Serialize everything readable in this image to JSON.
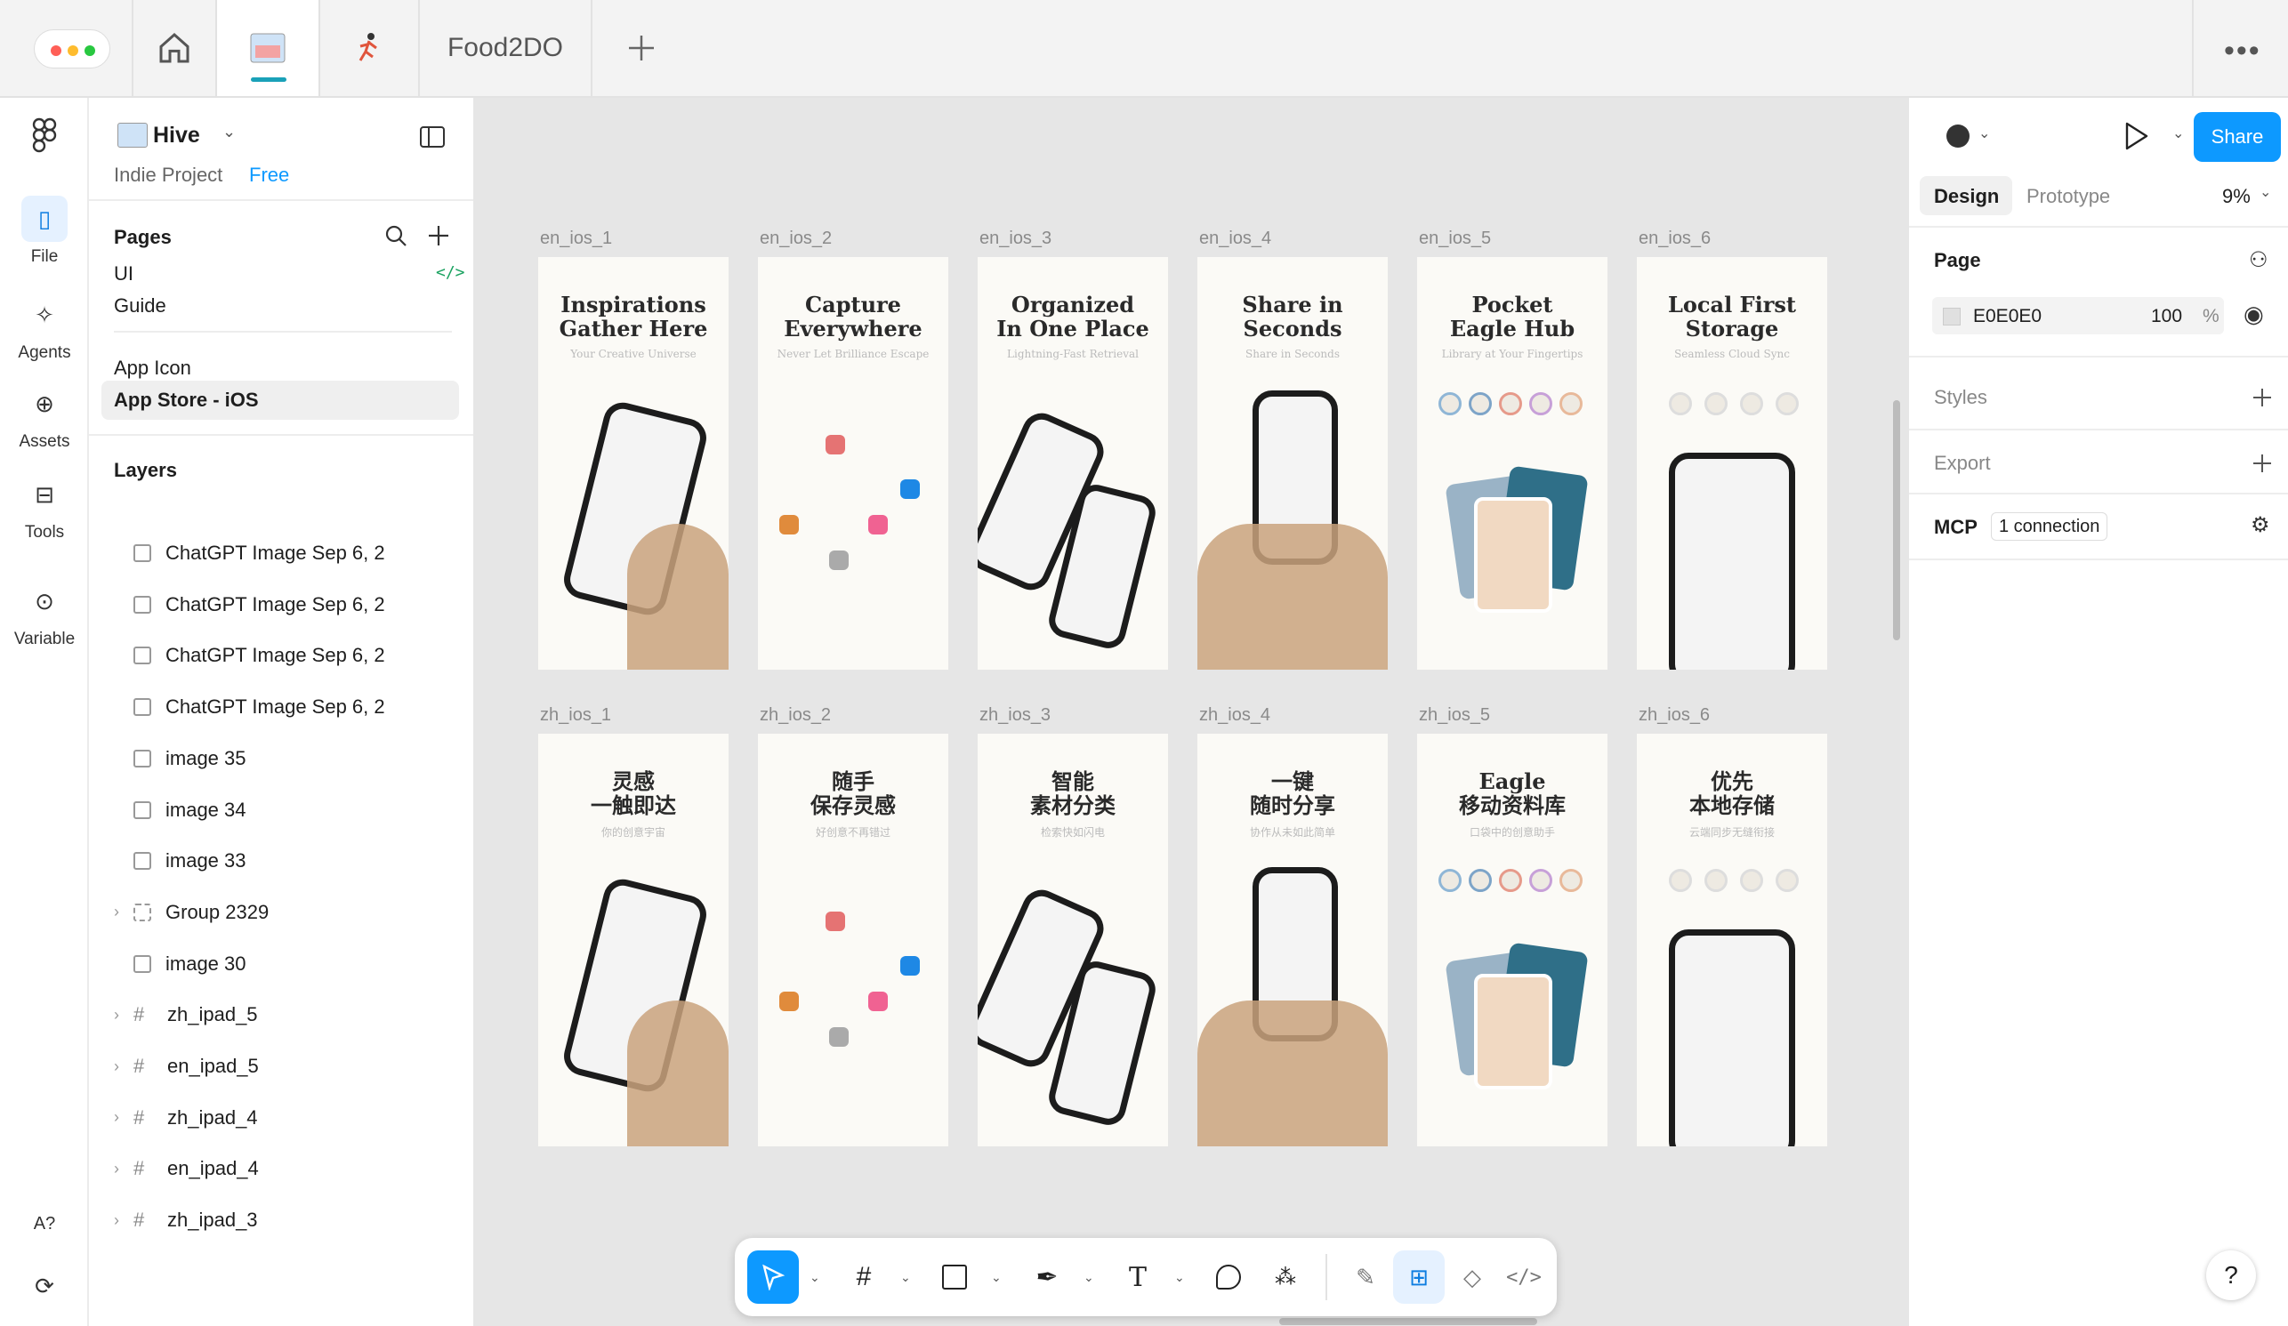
{
  "tabs": {
    "file_tab_label": "Food2DO"
  },
  "rail": {
    "file": "File",
    "agents": "Agents",
    "assets": "Assets",
    "tools": "Tools",
    "variables": "Variable"
  },
  "project": {
    "name": "Hive",
    "team": "Indie Project",
    "plan": "Free"
  },
  "pages": {
    "header": "Pages",
    "items": [
      "UI",
      "Guide",
      "App Icon",
      "App Store - iOS"
    ]
  },
  "layers": {
    "header": "Layers",
    "items": [
      {
        "label": "ChatGPT Image Sep 6, 2",
        "kind": "image"
      },
      {
        "label": "ChatGPT Image Sep 6, 2",
        "kind": "image"
      },
      {
        "label": "ChatGPT Image Sep 6, 2",
        "kind": "image"
      },
      {
        "label": "ChatGPT Image Sep 6, 2",
        "kind": "image"
      },
      {
        "label": "image 35",
        "kind": "image"
      },
      {
        "label": "image 34",
        "kind": "image"
      },
      {
        "label": "image 33",
        "kind": "image"
      },
      {
        "label": "Group 2329",
        "kind": "group"
      },
      {
        "label": "image 30",
        "kind": "image"
      },
      {
        "label": "zh_ipad_5",
        "kind": "frame"
      },
      {
        "label": "en_ipad_5",
        "kind": "frame"
      },
      {
        "label": "zh_ipad_4",
        "kind": "frame"
      },
      {
        "label": "en_ipad_4",
        "kind": "frame"
      },
      {
        "label": "zh_ipad_3",
        "kind": "frame"
      }
    ]
  },
  "frames": [
    {
      "label": "en_ios_1",
      "title": "Inspirations\nGather Here",
      "sub": "Your Creative Universe"
    },
    {
      "label": "en_ios_2",
      "title": "Capture\nEverywhere",
      "sub": "Never Let Brilliance Escape"
    },
    {
      "label": "en_ios_3",
      "title": "Organized\nIn One Place",
      "sub": "Lightning-Fast Retrieval"
    },
    {
      "label": "en_ios_4",
      "title": "Share in\nSeconds",
      "sub": "Share in Seconds"
    },
    {
      "label": "en_ios_5",
      "title": "Pocket\nEagle Hub",
      "sub": "Library at Your Fingertips"
    },
    {
      "label": "en_ios_6",
      "title": "Local First\nStorage",
      "sub": "Seamless Cloud Sync"
    },
    {
      "label": "zh_ios_1",
      "title": "灵感\n一触即达",
      "sub": "你的创意宇宙"
    },
    {
      "label": "zh_ios_2",
      "title": "随手\n保存灵感",
      "sub": "好创意不再错过"
    },
    {
      "label": "zh_ios_3",
      "title": "智能\n素材分类",
      "sub": "检索快如闪电"
    },
    {
      "label": "zh_ios_4",
      "title": "一键\n随时分享",
      "sub": "协作从未如此简单"
    },
    {
      "label": "zh_ios_5",
      "title": "Eagle\n移动资料库",
      "sub": "口袋中的创意助手"
    },
    {
      "label": "zh_ios_6",
      "title": "优先\n本地存储",
      "sub": "云端同步无缝衔接"
    }
  ],
  "right": {
    "share": "Share",
    "design": "Design",
    "prototype": "Prototype",
    "zoom": "9%",
    "page": "Page",
    "color": "E0E0E0",
    "opacity": "100",
    "pct": "%",
    "styles": "Styles",
    "export": "Export",
    "mcp": "MCP",
    "mcp_conn": "1 connection"
  },
  "help": "?",
  "colors": {
    "accent": "#0d99ff",
    "canvas": "#e6e6e6",
    "page_swatch": "#e0e0e0"
  }
}
